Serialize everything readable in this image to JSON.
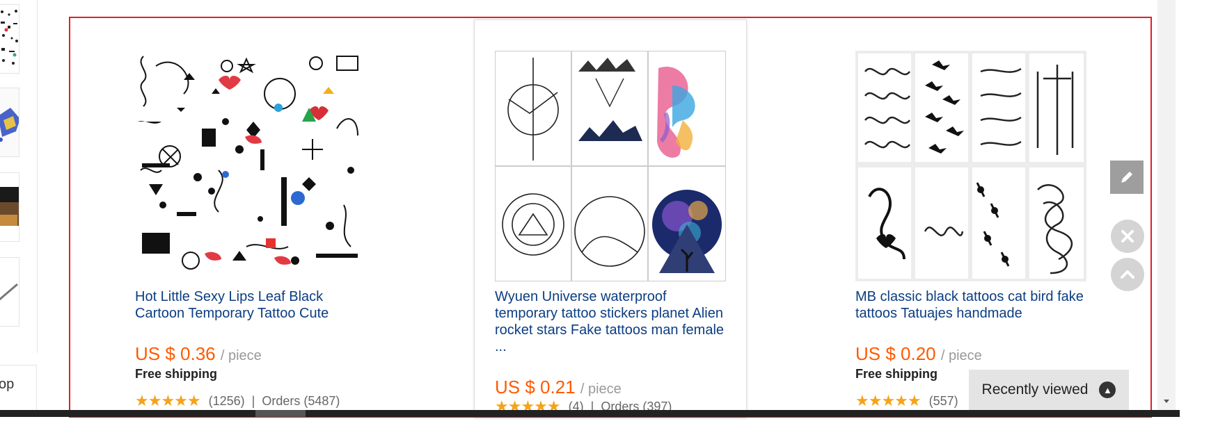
{
  "products": [
    {
      "title": "Hot Little Sexy Lips Leaf Black Cartoon Temporary Tattoo Cute",
      "price": "US $ 0.36",
      "unit": "/ piece",
      "shipping": "Free shipping",
      "reviews": "(1256)",
      "separator": "|",
      "orders": "Orders (5487)",
      "rating": 4.5
    },
    {
      "title": "Wyuen Universe waterproof temporary tattoo stickers planet Alien rocket stars Fake tattoos man female ...",
      "price": "US $ 0.21",
      "unit": "/ piece",
      "reviews": "(4)",
      "separator": "|",
      "orders": "Orders (397)",
      "rating": 5
    },
    {
      "title": "MB classic black tattoos cat bird fake tattoos Tatuajes handmade",
      "price": "US $ 0.20",
      "unit": "/ piece",
      "shipping": "Free shipping",
      "reviews": "(557)",
      "rating": 5
    }
  ],
  "sidebar": {
    "partial_text": "op"
  },
  "recently_viewed": {
    "label": "Recently viewed"
  },
  "colors": {
    "frame": "#e31e24",
    "price": "#ff5a00",
    "title": "#0b3d82",
    "stars": "#f4a31a"
  },
  "icons": [
    "pencil-icon",
    "close-icon",
    "chevron-up-icon",
    "scroll-down-icon"
  ]
}
